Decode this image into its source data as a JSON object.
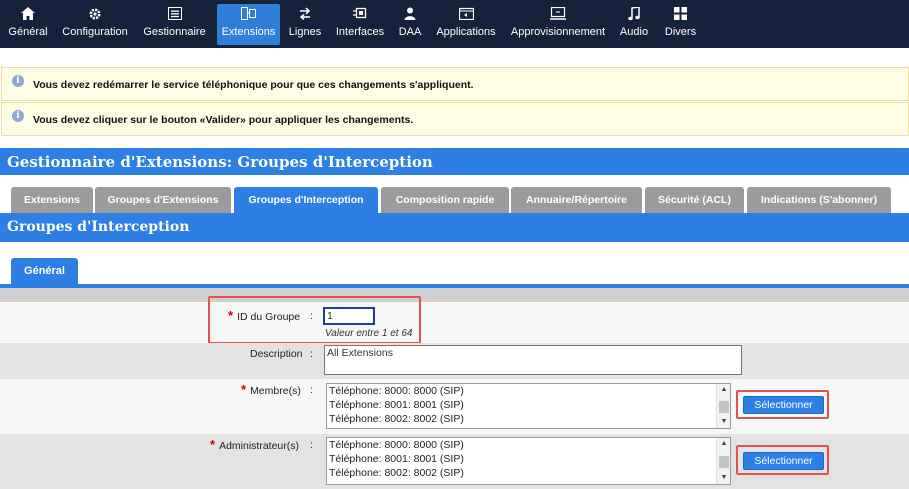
{
  "nav": [
    {
      "label": "Général",
      "icon": "home-icon"
    },
    {
      "label": "Configuration",
      "icon": "gear-icon"
    },
    {
      "label": "Gestionnaire",
      "icon": "list-icon"
    },
    {
      "label": "Extensions",
      "icon": "extensions-icon"
    },
    {
      "label": "Lignes",
      "icon": "lines-icon"
    },
    {
      "label": "Interfaces",
      "icon": "interfaces-icon"
    },
    {
      "label": "DAA",
      "icon": "person-icon"
    },
    {
      "label": "Applications",
      "icon": "applications-icon"
    },
    {
      "label": "Approvisionnement",
      "icon": "provisioning-icon"
    },
    {
      "label": "Audio",
      "icon": "music-note-icon"
    },
    {
      "label": "Divers",
      "icon": "grid-icon"
    }
  ],
  "nav_active": "Extensions",
  "notices": [
    "Vous devez redémarrer le service téléphonique pour que ces changements s'appliquent.",
    "Vous devez cliquer sur le bouton «Valider» pour appliquer les changements."
  ],
  "page_title": "Gestionnaire d'Extensions:  Groupes d'Interception",
  "tabs": [
    "Extensions",
    "Groupes d'Extensions",
    "Groupes d'Interception",
    "Composition rapide",
    "Annuaire/Répertoire",
    "Sécurité (ACL)",
    "Indications (S'abonner)"
  ],
  "active_tab": "Groupes d'Interception",
  "section_title": "Groupes d'Interception",
  "subtab": "Général",
  "form": {
    "group_id": {
      "label": "ID du Groupe",
      "value": "1",
      "hint": "Valeur entre 1 et 64",
      "required": true
    },
    "description": {
      "label": "Description",
      "value": "All Extensions"
    },
    "members": {
      "label": "Membre(s)",
      "required": true,
      "options": [
        "Téléphone: 8000: 8000 (SIP)",
        "Téléphone: 8001: 8001 (SIP)",
        "Téléphone: 8002: 8002 (SIP)"
      ],
      "button": "Sélectionner"
    },
    "admins": {
      "label": "Administrateur(s)",
      "required": true,
      "options": [
        "Téléphone: 8000: 8000 (SIP)",
        "Téléphone: 8001: 8001 (SIP)",
        "Téléphone: 8002: 8002 (SIP)"
      ],
      "button": "Sélectionner"
    },
    "colon": ":",
    "required_mark": "*"
  },
  "colors": {
    "nav_bg": "#16223b",
    "accent": "#2d7fe3",
    "tab_inactive": "#9b9b9b",
    "highlight": "#e05353",
    "notice_bg": "#fdfde3"
  }
}
